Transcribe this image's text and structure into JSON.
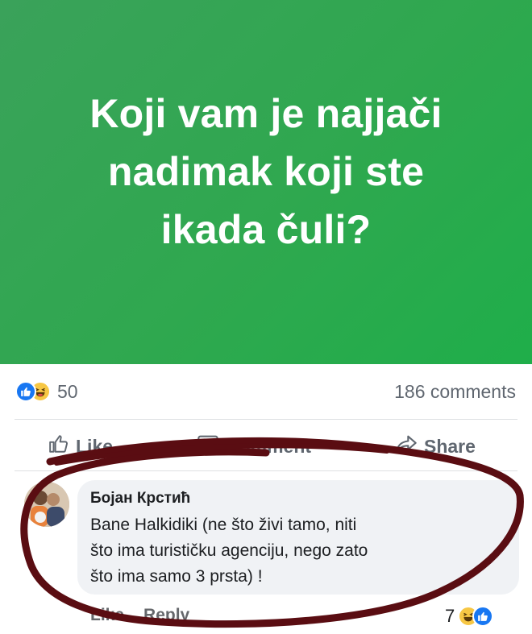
{
  "post": {
    "question": "Koji vam je najjači\nnadimak koji ste\nikada čuli?",
    "background_color": "#2fa84f"
  },
  "reactions": {
    "count": "50",
    "icons": [
      "like-icon",
      "haha-icon"
    ],
    "comments_count": "186 comments"
  },
  "actions": {
    "like": "Like",
    "comment": "Comment",
    "share": "Share"
  },
  "comment": {
    "author": "Бојан Крстић",
    "text": "Bane Halkidiki (ne što živi tamo, niti\nšto ima turističku agenciju, nego zato\nšto ima samo 3 prsta) !",
    "actions": {
      "like": "Like",
      "reply": "Reply"
    },
    "reaction_count": "7",
    "reaction_icons": [
      "haha-icon",
      "like-icon"
    ]
  },
  "colors": {
    "accent": "#1877f2",
    "scribble": "#5a0d12"
  }
}
